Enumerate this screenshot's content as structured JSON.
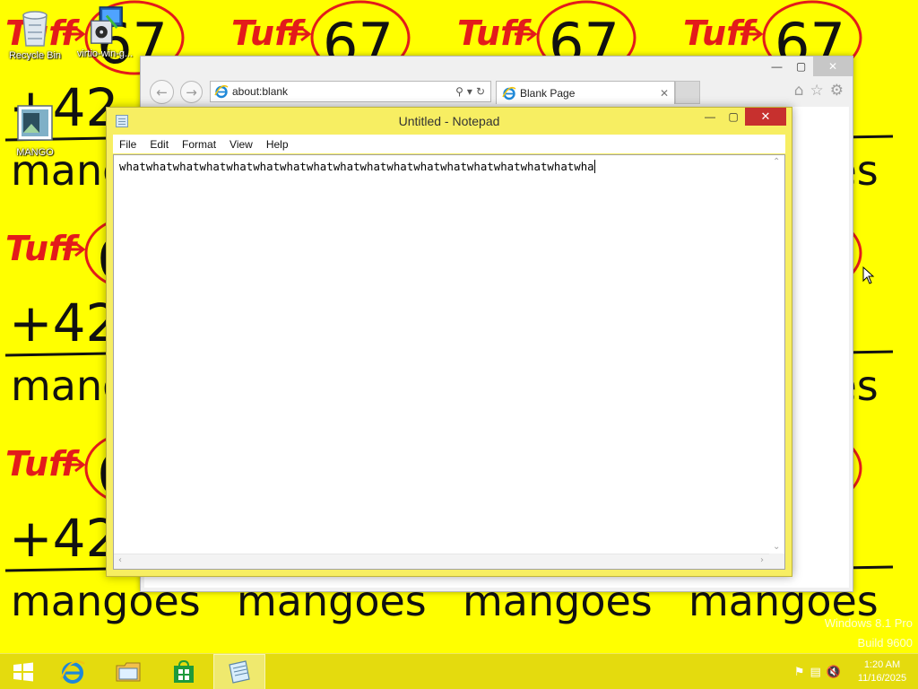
{
  "wallpaper": {
    "tag_text": "Tuff",
    "number_text": "67",
    "plus_text": "+42",
    "word_text": "mangoes",
    "colors": {
      "background": "#ffff00",
      "red": "#e31b1b",
      "black": "#111111"
    }
  },
  "desktop": {
    "icons": [
      {
        "label": "Recycle Bin",
        "icon": "recycle-bin-icon"
      },
      {
        "label": "virtio-win-g...",
        "icon": "installer-icon"
      },
      {
        "label": "MANGO",
        "icon": "image-file-icon"
      }
    ]
  },
  "ie": {
    "address": "about:blank",
    "tab_title": "Blank Page",
    "buttons": {
      "back": "back-icon",
      "forward": "forward-icon",
      "home": "home-icon",
      "favorites": "star-icon",
      "tools": "gear-icon"
    }
  },
  "notepad": {
    "title": "Untitled - Notepad",
    "menu": [
      "File",
      "Edit",
      "Format",
      "View",
      "Help"
    ],
    "content": "whatwhatwhatwhatwhatwhatwhatwhatwhatwhatwhatwhatwhatwhatwhatwhatwhatwha",
    "colors": {
      "frame": "#f7ee62",
      "close": "#c7302e"
    }
  },
  "watermark": {
    "line1": "Windows 8.1 Pro",
    "line2": "Build 9600"
  },
  "taskbar": {
    "items": [
      {
        "name": "start-button",
        "icon": "windows-logo-icon"
      },
      {
        "name": "internet-explorer",
        "icon": "ie-icon"
      },
      {
        "name": "file-explorer",
        "icon": "folder-icon"
      },
      {
        "name": "store",
        "icon": "store-icon"
      },
      {
        "name": "notepad",
        "icon": "notepad-icon",
        "active": true
      }
    ],
    "tray_icons": [
      "flag-icon",
      "network-icon",
      "volume-muted-icon"
    ],
    "time": "1:20 AM",
    "date": "11/16/2025"
  }
}
